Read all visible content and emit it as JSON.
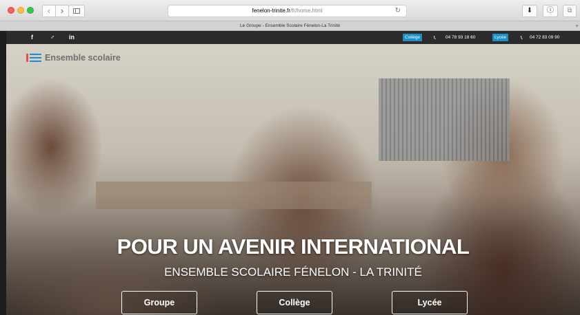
{
  "browser": {
    "url_domain": "fenelon-trinite.fr",
    "url_path": "/fr/home.html",
    "tab_title": "Le Groupe - Ensemble Scolaire Fénelon-La Trinité"
  },
  "topbar": {
    "social": [
      "f",
      "♂",
      "in"
    ],
    "college_label": "Collège",
    "college_phone": "04 78 93 18 60",
    "lycee_label": "Lycée",
    "lycee_phone": "04 72 83 09 90",
    "accent": "#1a8fc6"
  },
  "hero": {
    "logo_text": "Ensemble scolaire",
    "headline": "POUR UN AVENIR INTERNATIONAL",
    "subheadline": "ENSEMBLE SCOLAIRE FÉNELON - LA TRINITÉ",
    "buttons": [
      "Groupe",
      "Collège",
      "Lycée"
    ]
  }
}
